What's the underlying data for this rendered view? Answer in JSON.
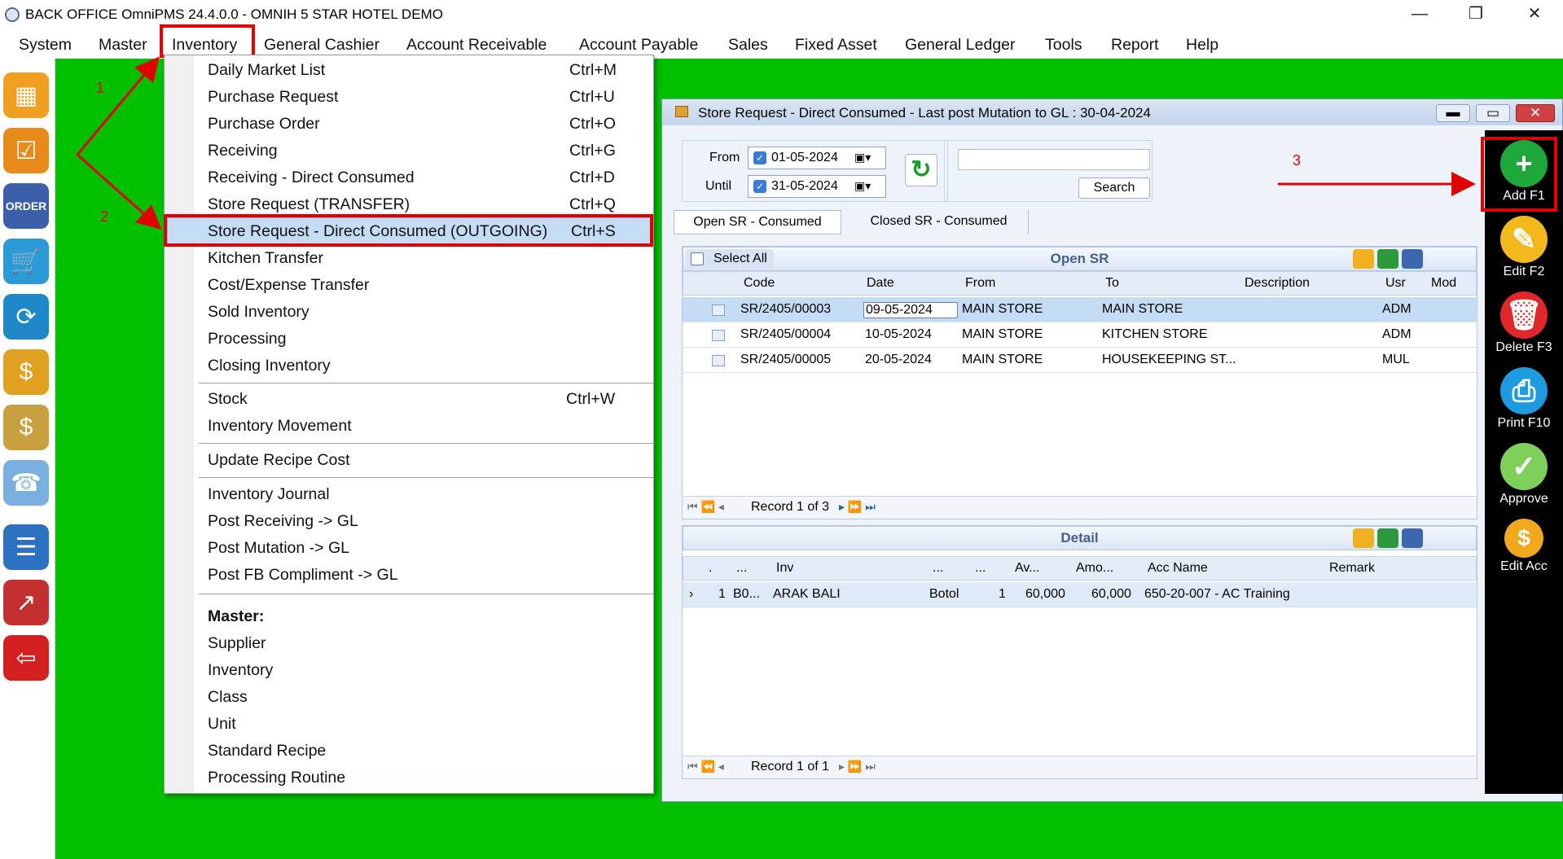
{
  "titlebar": {
    "title": "BACK OFFICE OmniPMS 24.4.0.0 - OMNIH 5 STAR HOTEL DEMO",
    "minimize": "—",
    "restore": "❐",
    "close": "✕"
  },
  "menubar": {
    "items": [
      "System",
      "Master",
      "Inventory",
      "General Cashier",
      "Account Receivable",
      "Account Payable",
      "Sales",
      "Fixed Asset",
      "General Ledger",
      "Tools",
      "Report",
      "Help"
    ]
  },
  "dropdown": {
    "items": [
      {
        "label": "Daily Market List",
        "shortcut": "Ctrl+M"
      },
      {
        "label": "Purchase Request",
        "shortcut": "Ctrl+U"
      },
      {
        "label": "Purchase Order",
        "shortcut": "Ctrl+O"
      },
      {
        "label": "Receiving",
        "shortcut": "Ctrl+G"
      },
      {
        "label": "Receiving - Direct Consumed",
        "shortcut": "Ctrl+D"
      },
      {
        "label": "Store Request (TRANSFER)",
        "shortcut": "Ctrl+Q"
      },
      {
        "label": "Store Request - Direct Consumed (OUTGOING)",
        "shortcut": "Ctrl+S"
      },
      {
        "label": "Kitchen Transfer",
        "shortcut": ""
      },
      {
        "label": "Cost/Expense Transfer",
        "shortcut": ""
      },
      {
        "label": "Sold Inventory",
        "shortcut": ""
      },
      {
        "label": "Processing",
        "shortcut": ""
      },
      {
        "label": "Closing Inventory",
        "shortcut": ""
      },
      {
        "label": "Stock",
        "shortcut": "Ctrl+W"
      },
      {
        "label": "Inventory Movement",
        "shortcut": ""
      },
      {
        "label": "Update Recipe Cost",
        "shortcut": ""
      },
      {
        "label": "Inventory Journal",
        "shortcut": ""
      },
      {
        "label": "Post Receiving -> GL",
        "shortcut": ""
      },
      {
        "label": "Post Mutation -> GL",
        "shortcut": ""
      },
      {
        "label": "Post FB Compliment -> GL",
        "shortcut": ""
      },
      {
        "label": "Master:",
        "shortcut": ""
      },
      {
        "label": "Supplier",
        "shortcut": ""
      },
      {
        "label": "Inventory",
        "shortcut": ""
      },
      {
        "label": "Class",
        "shortcut": ""
      },
      {
        "label": "Unit",
        "shortcut": ""
      },
      {
        "label": "Standard Recipe",
        "shortcut": ""
      },
      {
        "label": "Processing Routine",
        "shortcut": ""
      }
    ]
  },
  "window": {
    "title": "Store Request - Direct Consumed - Last post Mutation to GL : 30-04-2024",
    "from_label": "From",
    "from_value": "01-05-2024",
    "until_label": "Until",
    "until_value": "31-05-2024",
    "search_value": "",
    "search_button": "Search",
    "tabs": [
      "Open SR - Consumed",
      "Closed SR - Consumed"
    ],
    "select_all": "Select All",
    "open_sr_title": "Open SR",
    "grid_columns": [
      "Code",
      "Date",
      "From",
      "To",
      "Description",
      "Usr",
      "Mod"
    ],
    "grid_rows": [
      [
        "SR/2405/00003",
        "09-05-2024",
        "MAIN STORE",
        "MAIN STORE",
        "",
        "ADM",
        ""
      ],
      [
        "SR/2405/00004",
        "10-05-2024",
        "MAIN STORE",
        "KITCHEN STORE",
        "",
        "ADM",
        ""
      ],
      [
        "SR/2405/00005",
        "20-05-2024",
        "MAIN STORE",
        "HOUSEKEEPING ST...",
        "",
        "MUL",
        ""
      ]
    ],
    "grid_record": "Record 1 of 3",
    "detail_title": "Detail",
    "detail_columns": [
      ".",
      "...",
      "Inv",
      "...",
      "...",
      "Av...",
      "Amo...",
      "Acc Name",
      "Remark"
    ],
    "detail_rows": [
      [
        "1",
        "B0...",
        "ARAK BALI",
        "Botol",
        "1",
        "60,000",
        "60,000",
        "650-20-007 - AC Training",
        ""
      ]
    ],
    "detail_record": "Record 1 of 1"
  },
  "rightbar": {
    "buttons": [
      "Add F1",
      "Edit F2",
      "Delete F3",
      "Print F10",
      "Approve",
      "Edit Acc"
    ]
  },
  "annotations": {
    "one": "1",
    "two": "2",
    "three": "3"
  },
  "colors": {
    "accent_red": "#e00000",
    "background_green": "#00c000",
    "highlight": "#c5dcf5"
  }
}
